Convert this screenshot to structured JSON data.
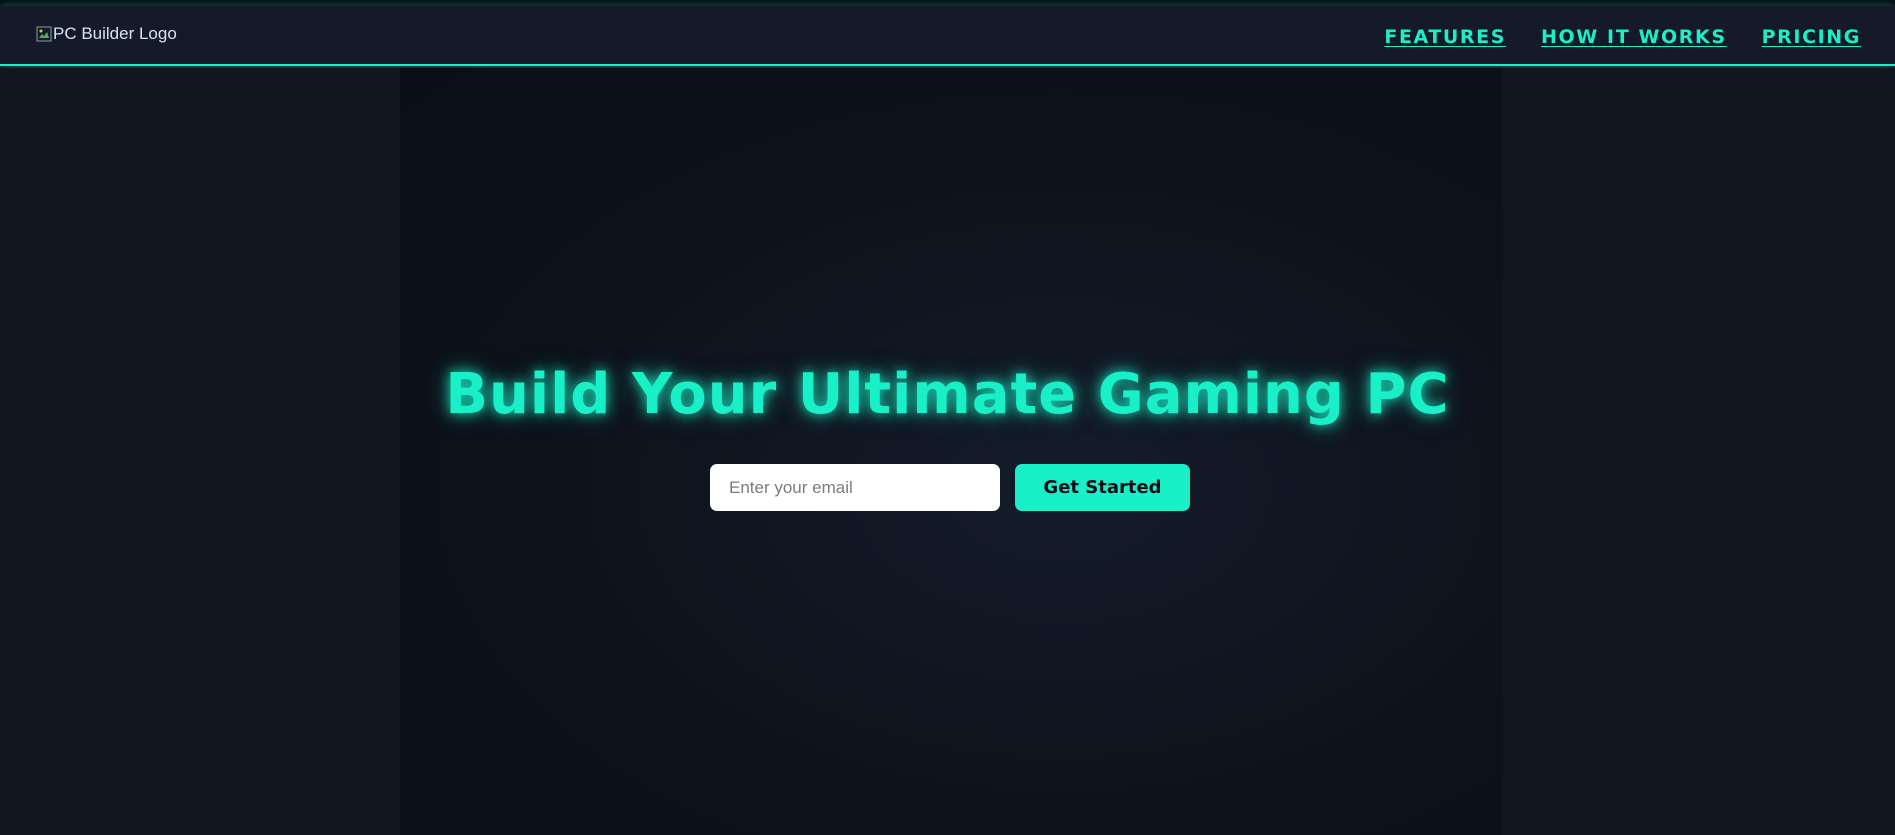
{
  "header": {
    "logo_alt": "PC Builder Logo",
    "nav": [
      {
        "label": "FEATURES"
      },
      {
        "label": "HOW IT WORKS"
      },
      {
        "label": "PRICING"
      }
    ]
  },
  "hero": {
    "title": "Build Your Ultimate Gaming PC",
    "email_placeholder": "Enter your email",
    "cta_label": "Get Started"
  },
  "colors": {
    "accent": "#19f0c8",
    "background": "#0f131c",
    "navbar": "#141a27"
  },
  "icons": {
    "logo": "broken-image-icon"
  }
}
